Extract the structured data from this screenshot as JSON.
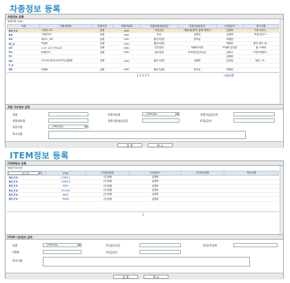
{
  "vehicle": {
    "heading": "차종정보 등록",
    "panel_title": "차종정보 등록",
    "sub_label": "등록차종 Total",
    "columns": [
      "차종",
      "차종세부명",
      "차량구분",
      "차종차입회",
      "차종차종생성공장",
      "차종차입담당자",
      "ICI담당자",
      "특기사항"
    ],
    "rows": [
      [
        "XG_F/L",
        "그랜저 XG",
        "승용",
        "HMC",
        "아산공장",
        "개발1팀/편의 설계 제약사",
        "김경희",
        "차후1년이..."
      ],
      [
        "XG",
        "그랜저XG",
        "승용",
        "HMC",
        "아산",
        "김중민",
        "김경희",
        "보험 생산T..."
      ],
      [
        "VX",
        "에쿠스_HD",
        "승용",
        "HMC",
        "울산3공장",
        "한지승",
        "박종현",
        ""
      ],
      [
        "XI_3",
        "엑센트",
        "승용",
        "HMC",
        "울산4공장",
        "",
        "박종현",
        "중국 현지 생..."
      ],
      [
        "VT",
        "2.5T 3.5T TRUCK",
        "상용",
        "HMC",
        "전주공장",
        "박동배 과장",
        "이재용 김성영",
        "을 158대"
      ],
      [
        "TU",
        "트론타이",
        "상용",
        "HMC",
        "광주공장",
        "이국현/김건우(승)",
        "김종수",
        "37톤(대형차..."
      ],
      [
        "TC",
        "",
        "",
        "",
        "",
        "",
        "김종현",
        ""
      ],
      [
        "TD",
        "CLICK(5도어)/GETZ(수출형)",
        "승용",
        "HMC",
        "울산1공장",
        "김종현",
        "남궁일",
        "생산 / 도..."
      ],
      [
        "T_3",
        "",
        "",
        "",
        "",
        "",
        "",
        ""
      ],
      [
        "SR",
        "리베로",
        "상용",
        "HMC",
        "울산5공장",
        "한지승",
        "박종현",
        ""
      ]
    ],
    "pages": "1 2 3 4 5",
    "next_link": "다음차종",
    "form_title": "차종 기초정보 입력",
    "f_model": "차종",
    "f_detail": "차종세부명",
    "f_class": "차량구분",
    "f_class_value": "--선택하세요--",
    "f_note": "특기사항",
    "f_maker": "차종차입회",
    "f_maker_value": "--선택하세요--",
    "f_plant": "차종차종생성공장",
    "f_owner": "차종차입담당자",
    "f_ici": "ICI담당자",
    "btn_save": "등 록",
    "btn_cancel": "취 소"
  },
  "item": {
    "heading": "ITEM정보 등록",
    "panel_title": "ITEM정보 등록",
    "sub_label": "등록ITEM 6개",
    "filter_value": "XG_F/L",
    "columns": [
      "",
      "ITEM",
      "ICI생산공장",
      "ICI담당자",
      "ICI차주업체",
      "특기사항"
    ],
    "rows": [
      [
        "XG_F/L",
        "CONT-L",
        "(주)한림",
        "김경희",
        "",
        ""
      ],
      [
        "XG_F/L",
        "CONT-R",
        "(주)한림",
        "김경희",
        "",
        ""
      ],
      [
        "XG_F/L",
        "ENG",
        "(주)한림",
        "김경희",
        "",
        ""
      ],
      [
        "XG_F/L",
        "FLOOR",
        "(주)한림",
        "김경희",
        "",
        ""
      ],
      [
        "XG_F/L",
        "INST",
        "(주)한림",
        "김경희",
        "",
        ""
      ],
      [
        "XG_F/L",
        "MAIN",
        "(주)한림",
        "김경희",
        "",
        ""
      ]
    ],
    "pages": "1",
    "form_title": "ITEM 기초정보 입력",
    "f_model": "차종",
    "f_model_value": "--선택하세요--",
    "f_item": "ITEM",
    "f_note": "특기사항",
    "f_plant": "ICI생산공장",
    "f_owner": "ICI담당자",
    "f_vendor": "ICI차주업체",
    "btn_save": "등 록",
    "btn_cancel": "취 소"
  }
}
